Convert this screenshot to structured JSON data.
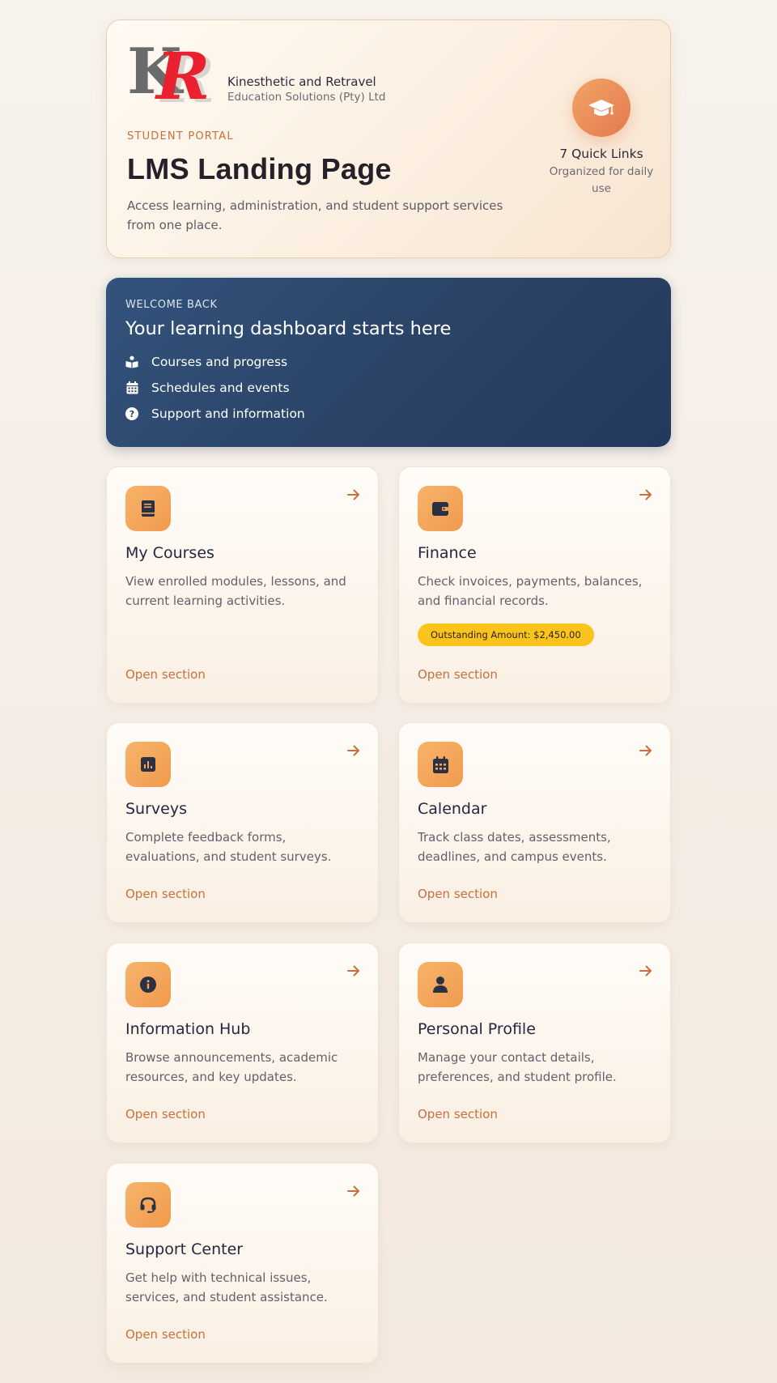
{
  "hero": {
    "logo_text": "KR",
    "company_line1": "Kinesthetic and Retravel",
    "company_line2": "Education Solutions (Pty) Ltd",
    "eyebrow": "STUDENT PORTAL",
    "title": "LMS Landing Page",
    "description": "Access learning, administration, and student support services from one place.",
    "quick_links": {
      "count_label": "7 Quick Links",
      "sub_label": "Organized for daily use",
      "icon": "graduation-cap-icon"
    }
  },
  "welcome": {
    "eyebrow": "WELCOME BACK",
    "title": "Your learning dashboard starts here",
    "items": [
      {
        "icon": "book-reader-icon",
        "label": "Courses and progress"
      },
      {
        "icon": "calendar-icon",
        "label": "Schedules and events"
      },
      {
        "icon": "question-circle-icon",
        "label": "Support and information"
      }
    ]
  },
  "cards": [
    {
      "title": "My Courses",
      "description": "View enrolled modules, lessons, and current learning activities.",
      "link": "Open section",
      "icon": "book-icon"
    },
    {
      "title": "Finance",
      "description": "Check invoices, payments, balances, and financial records.",
      "link": "Open section",
      "icon": "wallet-icon",
      "badge": "Outstanding Amount: $2,450.00"
    },
    {
      "title": "Surveys",
      "description": "Complete feedback forms, evaluations, and student surveys.",
      "link": "Open section",
      "icon": "poll-icon"
    },
    {
      "title": "Calendar",
      "description": "Track class dates, assessments, deadlines, and campus events.",
      "link": "Open section",
      "icon": "calendar-icon"
    },
    {
      "title": "Information Hub",
      "description": "Browse announcements, academic resources, and key updates.",
      "link": "Open section",
      "icon": "info-circle-icon"
    },
    {
      "title": "Personal Profile",
      "description": "Manage your contact details, preferences, and student profile.",
      "link": "Open section",
      "icon": "user-icon"
    },
    {
      "title": "Support Center",
      "description": "Get help with technical issues, services, and student assistance.",
      "link": "Open section",
      "icon": "headset-icon"
    }
  ],
  "colors": {
    "accent": "#c8703c",
    "icon_tile": "#f5a95c",
    "welcome_bg": "#2b4468",
    "badge": "#fbc31c",
    "logo_red": "#e8202f"
  }
}
